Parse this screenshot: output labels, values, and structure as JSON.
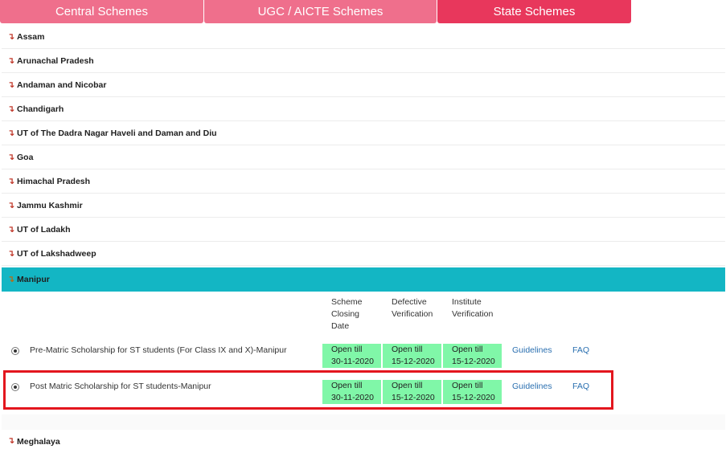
{
  "tabs": [
    {
      "label": "Central Schemes",
      "active": false
    },
    {
      "label": "UGC / AICTE Schemes",
      "active": false
    },
    {
      "label": "State Schemes",
      "active": true
    }
  ],
  "arrow_glyph": "↴",
  "states": [
    "Assam",
    "Arunachal Pradesh",
    "Andaman and Nicobar",
    "Chandigarh",
    "UT of The Dadra Nagar Haveli and Daman and Diu",
    "Goa",
    "Himachal Pradesh",
    "Jammu Kashmir",
    "UT of Ladakh",
    "UT of Lakshadweep",
    "Manipur",
    "Meghalaya"
  ],
  "active_state": "Manipur",
  "columns": {
    "closing": "Scheme\nClosing\nDate",
    "defective": "Defective\nVerification",
    "institute": "Institute\nVerification"
  },
  "schemes": [
    {
      "name": "Pre-Matric Scholarship for ST students (For Class IX and X)-Manipur",
      "closing": [
        "Open till",
        "30-11-2020"
      ],
      "defective": [
        "Open till",
        "15-12-2020"
      ],
      "institute": [
        "Open till",
        "15-12-2020"
      ],
      "guidelines": "Guidelines",
      "faq": "FAQ"
    },
    {
      "name": "Post Matric Scholarship for ST students-Manipur",
      "closing": [
        "Open till",
        "30-11-2020"
      ],
      "defective": [
        "Open till",
        "15-12-2020"
      ],
      "institute": [
        "Open till",
        "15-12-2020"
      ],
      "guidelines": "Guidelines",
      "faq": "FAQ"
    }
  ],
  "colors": {
    "tab_inactive": "#ef6f8c",
    "tab_active": "#e8375c",
    "active_state_bg": "#13b6c4",
    "date_cell_bg": "#80f7a8",
    "highlight_border": "#e3161e",
    "link": "#2a6fb0"
  }
}
